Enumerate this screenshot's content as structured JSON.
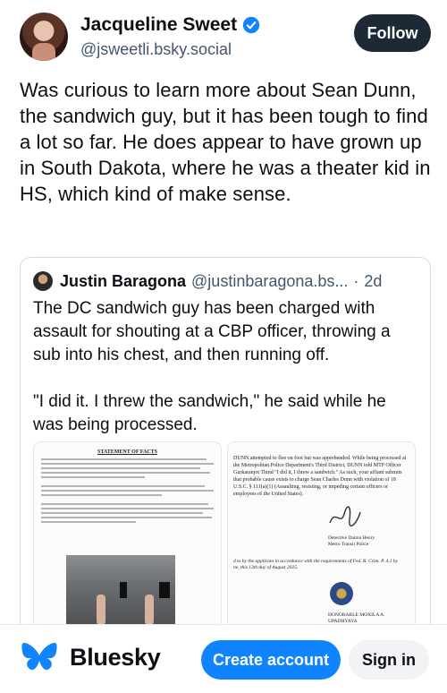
{
  "post": {
    "author": {
      "display_name": "Jacqueline Sweet",
      "handle": "@jsweetli.bsky.social",
      "verified_icon": "verified-check-icon"
    },
    "follow_label": "Follow",
    "text": "Was curious to learn more about Sean Dunn, the sandwich guy, but it has been tough to find a lot so far. He does appear to have grown up in South Dakota, where he was a theater kid in HS, which kind of make sense."
  },
  "quote": {
    "author": {
      "display_name": "Justin Baragona",
      "handle": "@justinbaragona.bs...",
      "separator": "·",
      "time": "2d"
    },
    "paragraphs": [
      "The DC sandwich guy has been charged with assault for shouting at a CBP officer, throwing a sub into his chest, and then running off.",
      "\"I did it. I threw the sandwich,\" he said while he was being processed."
    ],
    "images": {
      "doc1_title": "STATEMENT OF FACTS",
      "doc2_text": "DUNN attempted to flee on foot but was apprehended. While being processed at the Metropolitan Police Department's Third District, DUNN told MTP Officer Gurkaranjot Thind \"I did it, I threw a sandwich.\" As such, your affiant submits that probable cause exists to charge Sean Charles Dunn with violation of 18 U.S.C. § 111(a)(1) (Assaulting, resisting, or impeding certain officers or employees of the United States).",
      "signer": "Detective Daima Henry\nMetro Transit Police",
      "attest": "d to by the applicant in accordance with the requirements of Fed. R. Crim. P. 4.1 by\nne, this 13th day of August 2025.",
      "judge": "HONORABLE MOXILA A. UPADHYAYA\nUNITED STATES MAGISTRATE JUDGE"
    }
  },
  "bottom_bar": {
    "logo_text": "Bluesky",
    "create_account_label": "Create account",
    "sign_in_label": "Sign in"
  },
  "colors": {
    "accent": "#1083fe",
    "follow_bg": "#1e2936",
    "muted_text": "#42576c"
  }
}
